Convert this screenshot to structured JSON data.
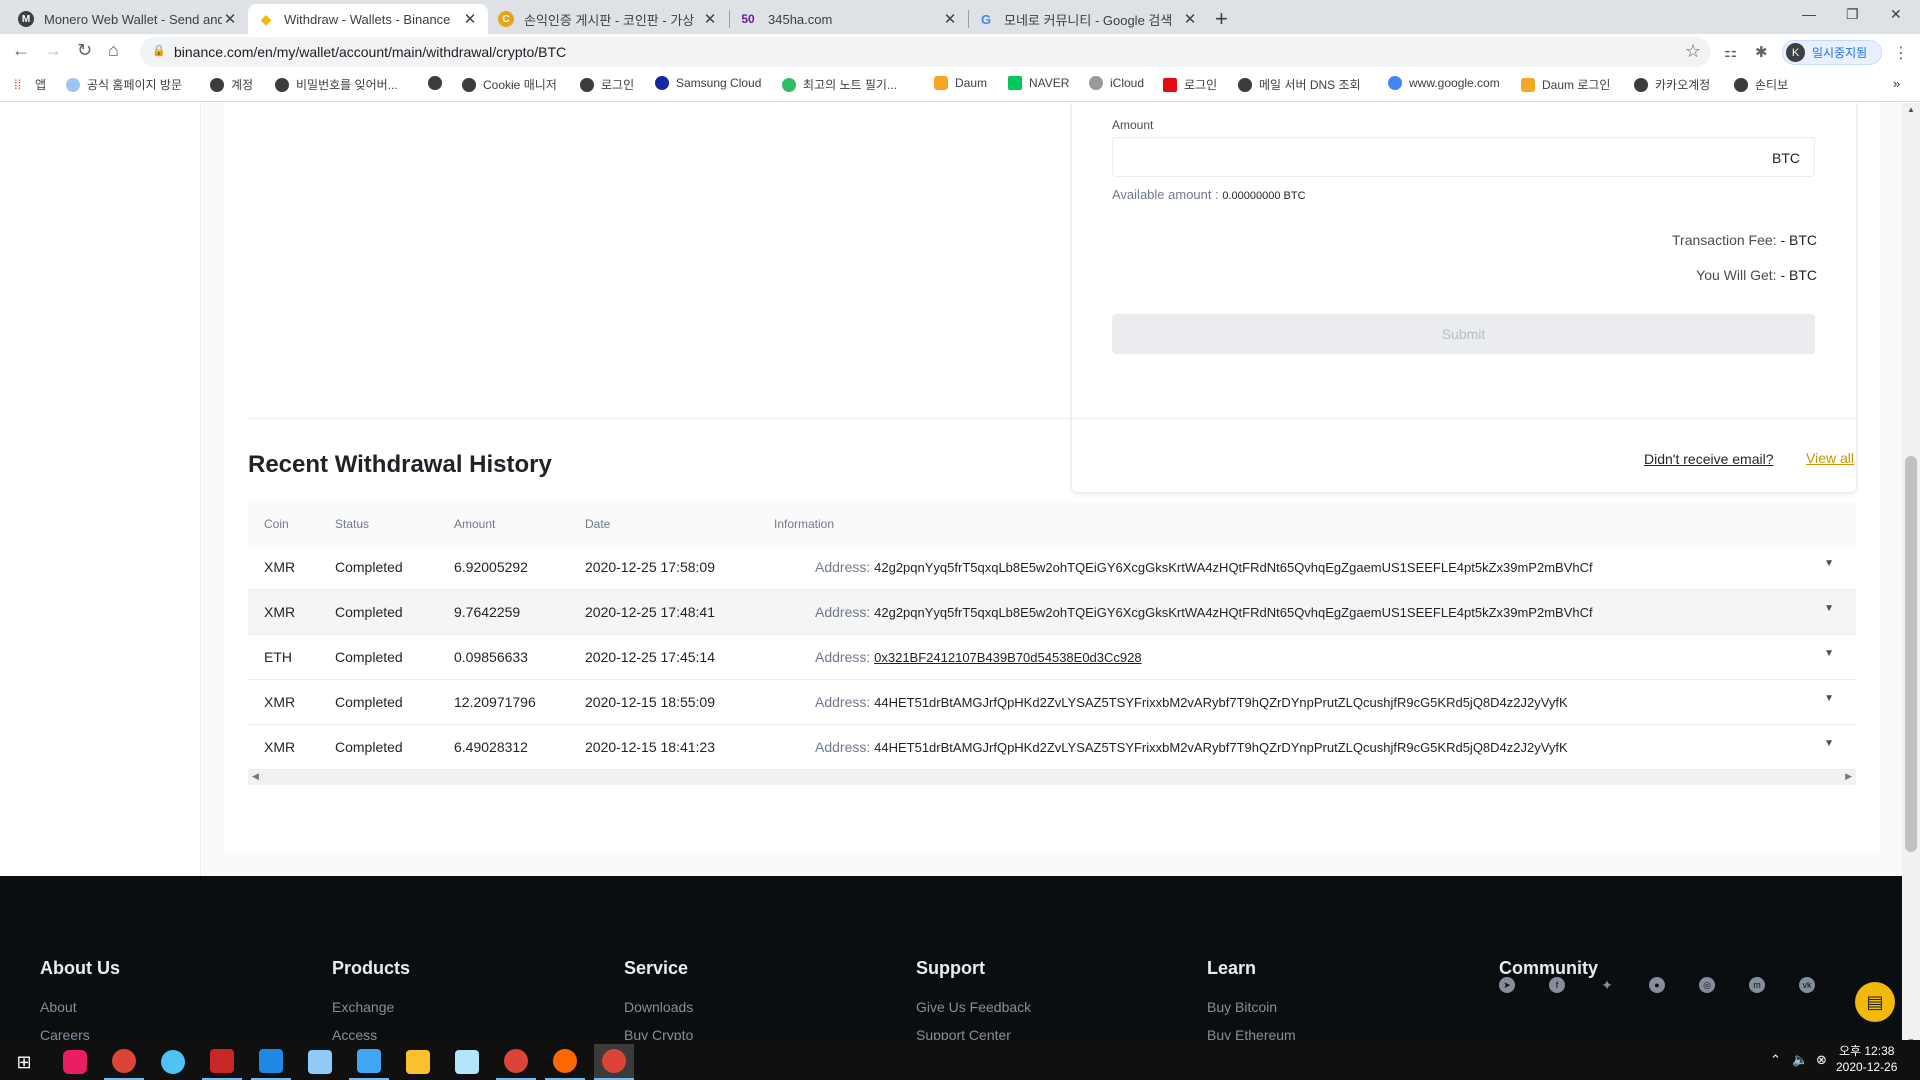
{
  "browser": {
    "tabs": [
      {
        "title": "Monero Web Wallet - Send and",
        "icon": "monero-icon",
        "color": "#3c4043"
      },
      {
        "title": "Withdraw - Wallets - Binance",
        "icon": "binance-icon",
        "color": "#f0b90b"
      },
      {
        "title": "손익인증 게시판 - 코인판 - 가상",
        "icon": "coinpan-icon",
        "color": "#e8a317"
      },
      {
        "title": "345ha.com",
        "icon": "50-icon",
        "color": "#6a1b9a"
      },
      {
        "title": "모네로 커뮤니티 - Google 검색",
        "icon": "google-icon",
        "color": "#4285f4"
      }
    ],
    "address": "binance.com/en/my/wallet/account/main/withdrawal/crypto/BTC",
    "profile_initial": "K",
    "profile_label": "일시중지됨",
    "bookmarks": [
      {
        "label": "앱",
        "icon": "apps-grid-icon"
      },
      {
        "label": "공식 홈페이지 방문",
        "icon": "globe-icon"
      },
      {
        "label": "계정",
        "icon": "kakao-icon"
      },
      {
        "label": "비밀번호를 잊어버...",
        "icon": "globe-icon"
      },
      {
        "label": "",
        "icon": "globe-icon"
      },
      {
        "label": "Cookie 매니저",
        "icon": "globe-icon"
      },
      {
        "label": "로그인",
        "icon": "globe-icon"
      },
      {
        "label": "Samsung Cloud",
        "icon": "samsung-cloud-icon"
      },
      {
        "label": "최고의 노트 필기...",
        "icon": "evernote-icon"
      },
      {
        "label": "Daum",
        "icon": "daum-icon"
      },
      {
        "label": "NAVER",
        "icon": "naver-icon"
      },
      {
        "label": "iCloud",
        "icon": "apple-icon"
      },
      {
        "label": "로그인",
        "icon": "netflix-icon"
      },
      {
        "label": "메일 서버 DNS 조회",
        "icon": "globe-icon"
      },
      {
        "label": "www.google.com",
        "icon": "google-icon"
      },
      {
        "label": "Daum 로그인",
        "icon": "daum-icon"
      },
      {
        "label": "카카오계정",
        "icon": "kakao-icon"
      },
      {
        "label": "손티보",
        "icon": "globe-icon"
      }
    ],
    "more": "»"
  },
  "form": {
    "amount_label": "Amount",
    "amount_value": "",
    "amount_unit": "BTC",
    "available_label": "Available amount :",
    "available_value": "0.00000000 BTC",
    "fee_label": "Transaction Fee:",
    "fee_value": "- BTC",
    "get_label": "You Will Get:",
    "get_value": "- BTC",
    "submit_label": "Submit"
  },
  "history": {
    "title": "Recent Withdrawal History",
    "didnt_receive": "Didn't receive email?",
    "view_all": "View all",
    "columns": [
      "Coin",
      "Status",
      "Amount",
      "Date",
      "Information"
    ],
    "address_label": "Address:",
    "rows": [
      {
        "coin": "XMR",
        "status": "Completed",
        "amount": "6.92005292",
        "date": "2020-12-25 17:58:09",
        "address": "42g2pqnYyq5frT5qxqLb8E5w2ohTQEiGY6XcgGksKrtWA4zHQtFRdNt65QvhqEgZgaemUS1SEEFLE4pt5kZx39mP2mBVhCf"
      },
      {
        "coin": "XMR",
        "status": "Completed",
        "amount": "9.7642259",
        "date": "2020-12-25 17:48:41",
        "address": "42g2pqnYyq5frT5qxqLb8E5w2ohTQEiGY6XcgGksKrtWA4zHQtFRdNt65QvhqEgZgaemUS1SEEFLE4pt5kZx39mP2mBVhCf"
      },
      {
        "coin": "ETH",
        "status": "Completed",
        "amount": "0.09856633",
        "date": "2020-12-25 17:45:14",
        "address": "0x321BF2412107B439B70d54538E0d3Cc928"
      },
      {
        "coin": "XMR",
        "status": "Completed",
        "amount": "12.20971796",
        "date": "2020-12-15 18:55:09",
        "address": "44HET51drBtAMGJrfQpHKd2ZvLYSAZ5TSYFrixxbM2vARybf7T9hQZrDYnpPrutZLQcushjfR9cG5KRd5jQ8D4z2J2yVyfK"
      },
      {
        "coin": "XMR",
        "status": "Completed",
        "amount": "6.49028312",
        "date": "2020-12-15 18:41:23",
        "address": "44HET51drBtAMGJrfQpHKd2ZvLYSAZ5TSYFrixxbM2vARybf7T9hQZrDYnpPrutZLQcushjfR9cG5KRd5jQ8D4z2J2yVyfK"
      }
    ]
  },
  "footer": {
    "columns": [
      {
        "title": "About Us",
        "links": [
          "About",
          "Careers"
        ]
      },
      {
        "title": "Products",
        "links": [
          "Exchange",
          "Access"
        ]
      },
      {
        "title": "Service",
        "links": [
          "Downloads",
          "Buy Crypto"
        ]
      },
      {
        "title": "Support",
        "links": [
          "Give Us Feedback",
          "Support Center"
        ]
      },
      {
        "title": "Learn",
        "links": [
          "Buy Bitcoin",
          "Buy Ethereum"
        ]
      },
      {
        "title": "Community",
        "links": []
      }
    ],
    "social": [
      "telegram-icon",
      "facebook-icon",
      "twitter-icon",
      "reddit-icon",
      "instagram-icon",
      "coinmarketcap-icon",
      "vk-icon"
    ]
  },
  "taskbar": {
    "clock_time": "오후 12:38",
    "clock_date": "2020-12-26"
  },
  "colors": {
    "brand": "#f0b90b",
    "link": "#c99400",
    "footer_bg": "#0b0e11"
  }
}
